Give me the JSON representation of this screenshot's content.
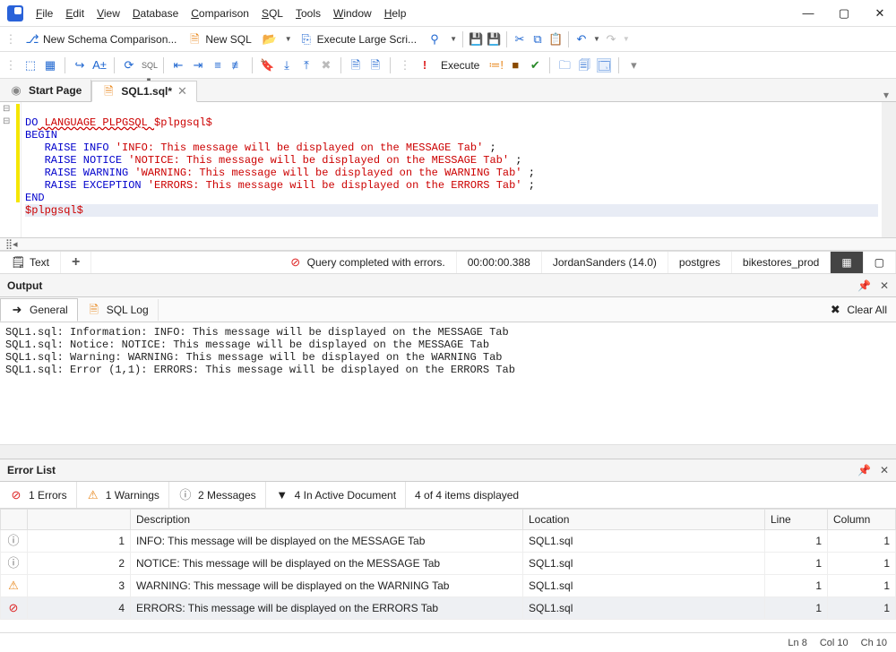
{
  "menu": {
    "file": "File",
    "edit": "Edit",
    "view": "View",
    "database": "Database",
    "comparison": "Comparison",
    "sql": "SQL",
    "tools": "Tools",
    "window": "Window",
    "help": "Help"
  },
  "toolbar": {
    "newSchema": "New Schema Comparison...",
    "newSql": "New SQL",
    "execLarge": "Execute Large Scri...",
    "execute": "Execute"
  },
  "tabs": {
    "start": "Start Page",
    "sql1": "SQL1.sql*"
  },
  "code": {
    "l1a": "DO",
    "l1b": " LANGUAGE PLPGSQL ",
    "l1c": "$plpgsql$",
    "l2": "BEGIN",
    "l3a": "   RAISE INFO ",
    "l3b": "'INFO: This message will be displayed on the MESSAGE Tab'",
    "l3c": " ;",
    "l4a": "   RAISE NOTICE ",
    "l4b": "'NOTICE: This message will be displayed on the MESSAGE Tab'",
    "l4c": " ;",
    "l5a": "   RAISE WARNING ",
    "l5b": "'WARNING: This message will be displayed on the WARNING Tab'",
    "l5c": " ;",
    "l6a": "   RAISE EXCEPTION ",
    "l6b": "'ERRORS: This message will be displayed on the ERRORS Tab'",
    "l6c": " ;",
    "l7": "END",
    "l8": "$plpgsql$"
  },
  "status": {
    "textBtn": "Text",
    "queryResult": "Query completed with errors.",
    "elapsed": "00:00:00.388",
    "user": "JordanSanders (14.0)",
    "server": "postgres",
    "db": "bikestores_prod"
  },
  "output": {
    "title": "Output",
    "general": "General",
    "sqlLog": "SQL Log",
    "clearAll": "Clear All",
    "lines": [
      "SQL1.sql: Information: INFO: This message will be displayed on the MESSAGE Tab",
      "SQL1.sql: Notice: NOTICE: This message will be displayed on the MESSAGE Tab",
      "SQL1.sql: Warning: WARNING: This message will be displayed on the WARNING Tab",
      "SQL1.sql: Error (1,1): ERRORS: This message will be displayed on the ERRORS Tab"
    ]
  },
  "errorlist": {
    "title": "Error List",
    "filters": {
      "errors": "1 Errors",
      "warnings": "1 Warnings",
      "messages": "2 Messages",
      "active": "4 In Active Document",
      "shown": "4 of 4 items displayed"
    },
    "cols": {
      "desc": "Description",
      "loc": "Location",
      "line": "Line",
      "col": "Column"
    },
    "rows": [
      {
        "n": "1",
        "icon": "info",
        "desc": "INFO: This message will be displayed on the MESSAGE Tab",
        "loc": "SQL1.sql",
        "line": "1",
        "col": "1"
      },
      {
        "n": "2",
        "icon": "info",
        "desc": "NOTICE: This message will be displayed on the MESSAGE Tab",
        "loc": "SQL1.sql",
        "line": "1",
        "col": "1"
      },
      {
        "n": "3",
        "icon": "warn",
        "desc": "WARNING: This message will be displayed on the WARNING Tab",
        "loc": "SQL1.sql",
        "line": "1",
        "col": "1"
      },
      {
        "n": "4",
        "icon": "error",
        "desc": "ERRORS: This message will be displayed on the ERRORS Tab",
        "loc": "SQL1.sql",
        "line": "1",
        "col": "1"
      }
    ]
  },
  "footer": {
    "ln": "Ln 8",
    "col": "Col 10",
    "ch": "Ch 10"
  }
}
